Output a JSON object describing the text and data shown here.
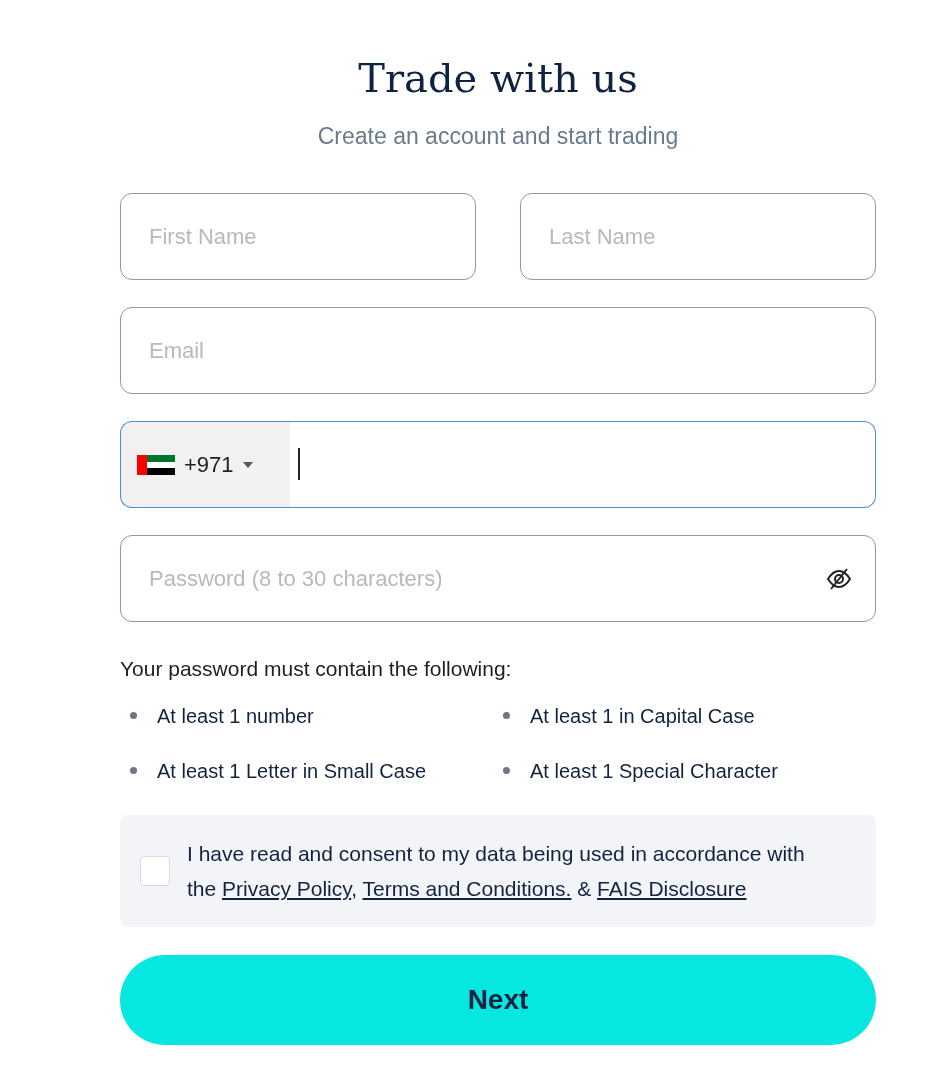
{
  "header": {
    "title": "Trade with us",
    "subtitle": "Create an account and start trading"
  },
  "form": {
    "rows": [
      [
        {
          "kind": "text",
          "placeholder": "First Name",
          "focused": false
        },
        {
          "kind": "text",
          "placeholder": "Last Name",
          "focused": false
        }
      ],
      [
        {
          "kind": "email",
          "placeholder": "Email",
          "focused": false
        }
      ],
      [
        {
          "kind": "phone",
          "dial_code": "+971",
          "focused": true
        }
      ],
      [
        {
          "kind": "password",
          "placeholder": "Password (8 to 30 characters)",
          "focused": false
        }
      ]
    ]
  },
  "password_rules": {
    "intro": "Your password must contain the following:",
    "items": [
      "At least 1 number",
      "At least 1 in Capital Case",
      "At least 1 Letter in Small Case",
      "At least 1 Special Character"
    ]
  },
  "consent": {
    "checked": false,
    "parts": [
      {
        "kind": "text",
        "text": "I have read and consent to my data being used in accordance with the "
      },
      {
        "kind": "link",
        "text": "Privacy Policy"
      },
      {
        "kind": "text",
        "text": ", "
      },
      {
        "kind": "link",
        "text": "Terms and Conditions."
      },
      {
        "kind": "text",
        "text": " & "
      },
      {
        "kind": "link",
        "text": "FAIS Disclosure"
      }
    ]
  },
  "submit": {
    "label": "Next"
  }
}
